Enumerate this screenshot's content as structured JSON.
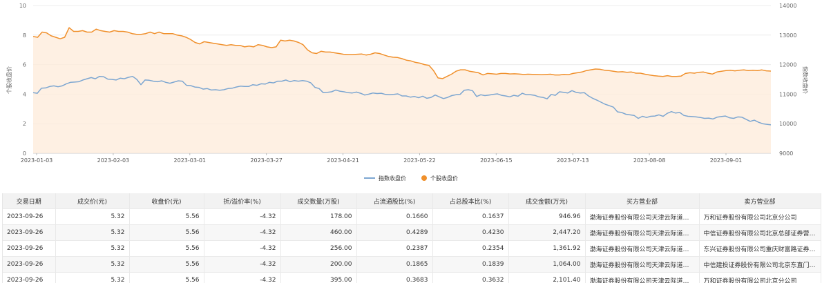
{
  "chart_data": {
    "type": "line",
    "x_ticks": [
      "2023-01-03",
      "2023-02-03",
      "2023-03-01",
      "2023-03-27",
      "2023-04-21",
      "2023-05-22",
      "2023-06-15",
      "2023-07-13",
      "2023-08-08",
      "2023-09-01"
    ],
    "y_left": {
      "label": "个股收盘价",
      "ticks": [
        0,
        2,
        4,
        6,
        8,
        10
      ],
      "lim": [
        0,
        10
      ]
    },
    "y_right": {
      "label": "指数收盘价",
      "ticks": [
        9000,
        10000,
        11000,
        12000,
        13000,
        14000
      ],
      "lim": [
        9000,
        14000
      ]
    },
    "grid": true,
    "legend": "bottom-center",
    "series": [
      {
        "name": "指数收盘价",
        "axis": "right",
        "color": "#7ca6d1",
        "values": [
          11050,
          11030,
          11200,
          11210,
          11260,
          11280,
          11250,
          11280,
          11350,
          11400,
          11410,
          11420,
          11480,
          11520,
          11560,
          11520,
          11600,
          11590,
          11510,
          11500,
          11480,
          11540,
          11520,
          11570,
          11600,
          11500,
          11320,
          11480,
          11470,
          11440,
          11420,
          11450,
          11400,
          11370,
          11410,
          11450,
          11440,
          11300,
          11290,
          11240,
          11230,
          11170,
          11190,
          11140,
          11150,
          11130,
          11150,
          11190,
          11200,
          11240,
          11270,
          11260,
          11260,
          11320,
          11300,
          11350,
          11340,
          11400,
          11380,
          11440,
          11440,
          11480,
          11420,
          11460,
          11440,
          11460,
          11440,
          11380,
          11230,
          11190,
          11050,
          11060,
          11080,
          11140,
          11100,
          11080,
          11050,
          11040,
          11070,
          11030,
          10970,
          11000,
          11040,
          11020,
          11030,
          10990,
          10980,
          10990,
          11010,
          10940,
          10940,
          10900,
          10920,
          10880,
          10930,
          10860,
          10890,
          10970,
          10910,
          10850,
          10890,
          10950,
          10980,
          10990,
          11130,
          11150,
          11120,
          10920,
          10980,
          10950,
          10970,
          10990,
          11010,
          10960,
          10940,
          10910,
          10960,
          10930,
          11030,
          10980,
          10980,
          10960,
          10910,
          10890,
          10840,
          10990,
          10960,
          11080,
          11060,
          11040,
          11120,
          11060,
          11040,
          11050,
          10940,
          10860,
          10800,
          10730,
          10660,
          10610,
          10560,
          10400,
          10380,
          10320,
          10300,
          10280,
          10180,
          10250,
          10210,
          10250,
          10260,
          10300,
          10250,
          10350,
          10410,
          10360,
          10380,
          10280,
          10250,
          10240,
          10230,
          10210,
          10180,
          10190,
          10160,
          10220,
          10240,
          10260,
          10200,
          10180,
          10230,
          10220,
          10150,
          10080,
          10120,
          10050,
          10000,
          9980,
          9960
        ]
      },
      {
        "name": "个股收盘价",
        "axis": "left",
        "color": "#f0902c",
        "values": [
          7.9,
          7.85,
          8.2,
          8.15,
          7.95,
          7.85,
          7.75,
          7.85,
          8.5,
          8.25,
          8.25,
          8.3,
          8.2,
          8.2,
          8.4,
          8.3,
          8.25,
          8.2,
          8.3,
          8.25,
          8.25,
          8.2,
          8.1,
          8.05,
          8.05,
          8.1,
          8.2,
          8.1,
          8.2,
          8.1,
          8.1,
          8.1,
          8.0,
          7.95,
          7.85,
          7.7,
          7.5,
          7.4,
          7.55,
          7.5,
          7.45,
          7.4,
          7.35,
          7.3,
          7.35,
          7.3,
          7.3,
          7.2,
          7.25,
          7.2,
          7.35,
          7.3,
          7.2,
          7.15,
          7.2,
          7.65,
          7.6,
          7.65,
          7.6,
          7.5,
          7.35,
          7.0,
          6.8,
          6.75,
          6.9,
          6.85,
          6.85,
          6.8,
          6.75,
          6.7,
          6.68,
          6.68,
          6.7,
          6.72,
          6.65,
          6.7,
          6.8,
          6.75,
          6.65,
          6.55,
          6.5,
          6.48,
          6.4,
          6.3,
          6.25,
          6.15,
          6.1,
          6.0,
          5.95,
          5.6,
          5.1,
          5.05,
          5.2,
          5.35,
          5.55,
          5.65,
          5.65,
          5.55,
          5.5,
          5.45,
          5.3,
          5.4,
          5.38,
          5.35,
          5.4,
          5.4,
          5.37,
          5.38,
          5.36,
          5.33,
          5.35,
          5.34,
          5.33,
          5.32,
          5.33,
          5.35,
          5.3,
          5.3,
          5.34,
          5.32,
          5.4,
          5.45,
          5.5,
          5.6,
          5.65,
          5.7,
          5.68,
          5.62,
          5.6,
          5.55,
          5.5,
          5.52,
          5.48,
          5.5,
          5.42,
          5.42,
          5.35,
          5.3,
          5.25,
          5.22,
          5.2,
          5.25,
          5.2,
          5.2,
          5.22,
          5.4,
          5.45,
          5.42,
          5.48,
          5.5,
          5.42,
          5.36,
          5.5,
          5.55,
          5.6,
          5.62,
          5.58,
          5.62,
          5.64,
          5.6,
          5.62,
          5.6,
          5.64,
          5.58,
          5.56
        ]
      }
    ]
  },
  "table": {
    "headers": [
      "交易日期",
      "成交价(元)",
      "收盘价(元)",
      "折/溢价率(%)",
      "成交数量(万股)",
      "占流通股比(%)",
      "占总股本比(%)",
      "成交金额(万元)",
      "买方营业部",
      "卖方营业部"
    ],
    "rows": [
      [
        "2023-09-26",
        "5.32",
        "5.56",
        "-4.32",
        "178.00",
        "0.1660",
        "0.1637",
        "946.96",
        "渤海证券股份有限公司天津云际道证券营业部",
        "万和证券股份有限公司北京分公司"
      ],
      [
        "2023-09-26",
        "5.32",
        "5.56",
        "-4.32",
        "460.00",
        "0.4289",
        "0.4230",
        "2,447.20",
        "渤海证券股份有限公司天津云际道证券营业部",
        "中信证券股份有限公司北京总部证券营业部"
      ],
      [
        "2023-09-26",
        "5.32",
        "5.56",
        "-4.32",
        "256.00",
        "0.2387",
        "0.2354",
        "1,361.92",
        "渤海证券股份有限公司天津云际道证券营业部",
        "东兴证券股份有限公司重庆财富路证券营业部"
      ],
      [
        "2023-09-26",
        "5.32",
        "5.56",
        "-4.32",
        "200.00",
        "0.1865",
        "0.1839",
        "1,064.00",
        "渤海证券股份有限公司天津云际道证券营业部",
        "中信建投证券股份有限公司北京东直门证券营业部"
      ],
      [
        "2023-09-26",
        "5.32",
        "5.56",
        "-4.32",
        "395.00",
        "0.3683",
        "0.3632",
        "2,101.40",
        "渤海证券股份有限公司天津云际道证券营业部",
        "万和证券股份有限公司北京分公司"
      ]
    ]
  }
}
